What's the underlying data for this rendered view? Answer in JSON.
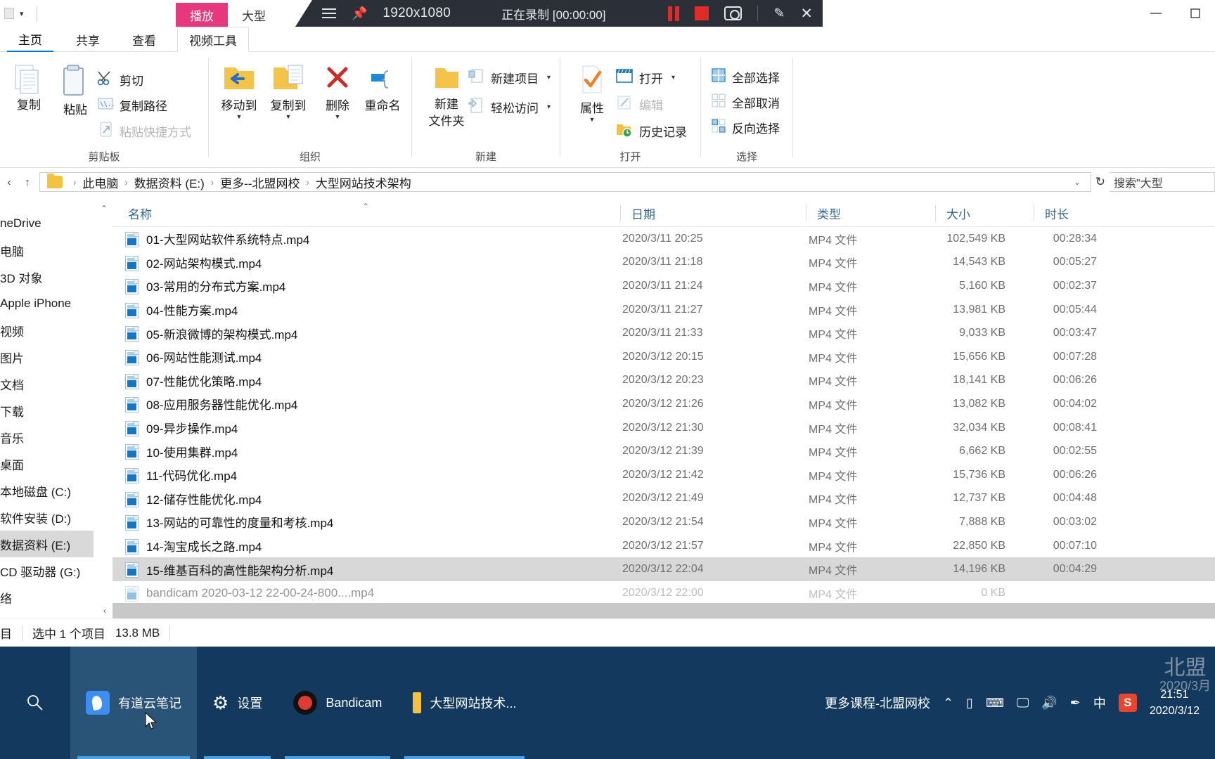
{
  "quick_access": {
    "caret": "▾"
  },
  "recorder": {
    "resolution": "1920x1080",
    "status": "正在录制 [00:00:00]",
    "hamburger_icon": "hamburger-icon",
    "pin_icon": "pin-icon"
  },
  "context_tabs": [
    {
      "label": "播放",
      "active": true
    },
    {
      "label": "大型",
      "active": false
    }
  ],
  "window_controls": {
    "minimize": "—",
    "maximize": "▢",
    "close": "✕"
  },
  "ribbon_tabs": [
    {
      "label": "主页",
      "active": true
    },
    {
      "label": "共享",
      "active": false
    },
    {
      "label": "查看",
      "active": false
    },
    {
      "label": "视频工具",
      "active": false,
      "boxed": true
    }
  ],
  "ribbon": {
    "clipboard": {
      "group_label": "剪贴板",
      "copy": "复制",
      "paste": "粘贴",
      "cut": "剪切",
      "copy_path": "复制路径",
      "paste_shortcut": "粘贴快捷方式"
    },
    "organize": {
      "group_label": "组织",
      "move_to": "移动到",
      "copy_to": "复制到",
      "delete": "删除",
      "rename": "重命名"
    },
    "new": {
      "group_label": "新建",
      "new_folder": "新建\n文件夹",
      "new_folder_l1": "新建",
      "new_folder_l2": "文件夹",
      "new_item": "新建项目",
      "easy_access": "轻松访问"
    },
    "open": {
      "group_label": "打开",
      "properties": "属性",
      "open": "打开",
      "edit": "编辑",
      "history": "历史记录"
    },
    "select": {
      "group_label": "选择",
      "select_all": "全部选择",
      "select_none": "全部取消",
      "invert_selection": "反向选择"
    }
  },
  "address_bar": {
    "back_icon": "back-chevron-icon",
    "up_icon": "up-arrow-icon",
    "folder_icon": "folder-icon",
    "breadcrumbs": [
      "此电脑",
      "数据资料 (E:)",
      "更多--北盟网校",
      "大型网站技术架构"
    ],
    "separator": "›",
    "dropdown": "⌄",
    "refresh": "↻",
    "search_value": "搜索\"大型"
  },
  "nav_pane": {
    "items": [
      {
        "label": "neDrive",
        "selected": false
      },
      {
        "label": "电脑",
        "selected": false
      },
      {
        "label": "3D 对象",
        "selected": false
      },
      {
        "label": "Apple iPhone",
        "selected": false
      },
      {
        "label": "视频",
        "selected": false
      },
      {
        "label": "图片",
        "selected": false
      },
      {
        "label": "文档",
        "selected": false
      },
      {
        "label": "下载",
        "selected": false
      },
      {
        "label": "音乐",
        "selected": false
      },
      {
        "label": "桌面",
        "selected": false
      },
      {
        "label": "本地磁盘 (C:)",
        "selected": false
      },
      {
        "label": "软件安装 (D:)",
        "selected": false
      },
      {
        "label": "数据资料 (E:)",
        "selected": true
      },
      {
        "label": "CD 驱动器 (G:)",
        "selected": false
      },
      {
        "label": "络",
        "selected": false
      }
    ],
    "scroll_up": "⌃",
    "scroll_down": "⌄"
  },
  "columns": {
    "name": "名称",
    "date": "日期",
    "type": "类型",
    "size": "大小",
    "duration": "时长",
    "sort_arrow": "⌃"
  },
  "files": [
    {
      "name": "01-大型网站软件系统特点.mp4",
      "date": "2020/3/11 20:25",
      "type": "MP4 文件",
      "size": "102,549 KB",
      "duration": "00:28:34",
      "selected": false
    },
    {
      "name": "02-网站架构模式.mp4",
      "date": "2020/3/11 21:18",
      "type": "MP4 文件",
      "size": "14,543 KB",
      "duration": "00:05:27",
      "selected": false
    },
    {
      "name": "03-常用的分布式方案.mp4",
      "date": "2020/3/11 21:24",
      "type": "MP4 文件",
      "size": "5,160 KB",
      "duration": "00:02:37",
      "selected": false
    },
    {
      "name": "04-性能方案.mp4",
      "date": "2020/3/11 21:27",
      "type": "MP4 文件",
      "size": "13,981 KB",
      "duration": "00:05:44",
      "selected": false
    },
    {
      "name": "05-新浪微博的架构模式.mp4",
      "date": "2020/3/11 21:33",
      "type": "MP4 文件",
      "size": "9,033 KB",
      "duration": "00:03:47",
      "selected": false
    },
    {
      "name": "06-网站性能测试.mp4",
      "date": "2020/3/12 20:15",
      "type": "MP4 文件",
      "size": "15,656 KB",
      "duration": "00:07:28",
      "selected": false
    },
    {
      "name": "07-性能优化策略.mp4",
      "date": "2020/3/12 20:23",
      "type": "MP4 文件",
      "size": "18,141 KB",
      "duration": "00:06:26",
      "selected": false
    },
    {
      "name": "08-应用服务器性能优化.mp4",
      "date": "2020/3/12 21:26",
      "type": "MP4 文件",
      "size": "13,082 KB",
      "duration": "00:04:02",
      "selected": false
    },
    {
      "name": "09-异步操作.mp4",
      "date": "2020/3/12 21:30",
      "type": "MP4 文件",
      "size": "32,034 KB",
      "duration": "00:08:41",
      "selected": false
    },
    {
      "name": "10-使用集群.mp4",
      "date": "2020/3/12 21:39",
      "type": "MP4 文件",
      "size": "6,662 KB",
      "duration": "00:02:55",
      "selected": false
    },
    {
      "name": "11-代码优化.mp4",
      "date": "2020/3/12 21:42",
      "type": "MP4 文件",
      "size": "15,736 KB",
      "duration": "00:06:26",
      "selected": false
    },
    {
      "name": "12-储存性能优化.mp4",
      "date": "2020/3/12 21:49",
      "type": "MP4 文件",
      "size": "12,737 KB",
      "duration": "00:04:48",
      "selected": false
    },
    {
      "name": "13-网站的可靠性的度量和考核.mp4",
      "date": "2020/3/12 21:54",
      "type": "MP4 文件",
      "size": "7,888 KB",
      "duration": "00:03:02",
      "selected": false
    },
    {
      "name": "14-淘宝成长之路.mp4",
      "date": "2020/3/12 21:57",
      "type": "MP4 文件",
      "size": "22,850 KB",
      "duration": "00:07:10",
      "selected": false
    },
    {
      "name": "15-维基百科的高性能架构分析.mp4",
      "date": "2020/3/12 22:04",
      "type": "MP4 文件",
      "size": "14,196 KB",
      "duration": "00:04:29",
      "selected": true
    },
    {
      "name": "bandicam 2020-03-12 22-00-24-800....mp4",
      "date": "2020/3/12 22:00",
      "type": "MP4 文件",
      "size": "0 KB",
      "duration": "",
      "selected": false
    }
  ],
  "status_bar": {
    "item_count": "目",
    "selection": "选中 1 个项目",
    "selection_size": "13.8 MB"
  },
  "taskbar": {
    "search_icon": "search-icon",
    "items": [
      {
        "label": "有道云笔记",
        "icon": "youdao-icon",
        "active": true
      },
      {
        "label": "设置",
        "icon": "gear-icon",
        "active": false
      },
      {
        "label": "Bandicam",
        "icon": "bandicam-icon",
        "active": false
      },
      {
        "label": "大型网站技术...",
        "icon": "folder-icon",
        "active": false
      }
    ],
    "tray_text": "更多课程-北盟网校",
    "tray_chevron": "⌃",
    "tray_icons": [
      "battery-icon",
      "keyboard-icon",
      "display-icon",
      "volume-icon",
      "pen-icon"
    ],
    "ime": "中",
    "sogou": "S",
    "clock_time": "21:51",
    "clock_date": "2020/3/12",
    "watermark_l1": "北盟",
    "watermark_l2": "2020/3月"
  }
}
